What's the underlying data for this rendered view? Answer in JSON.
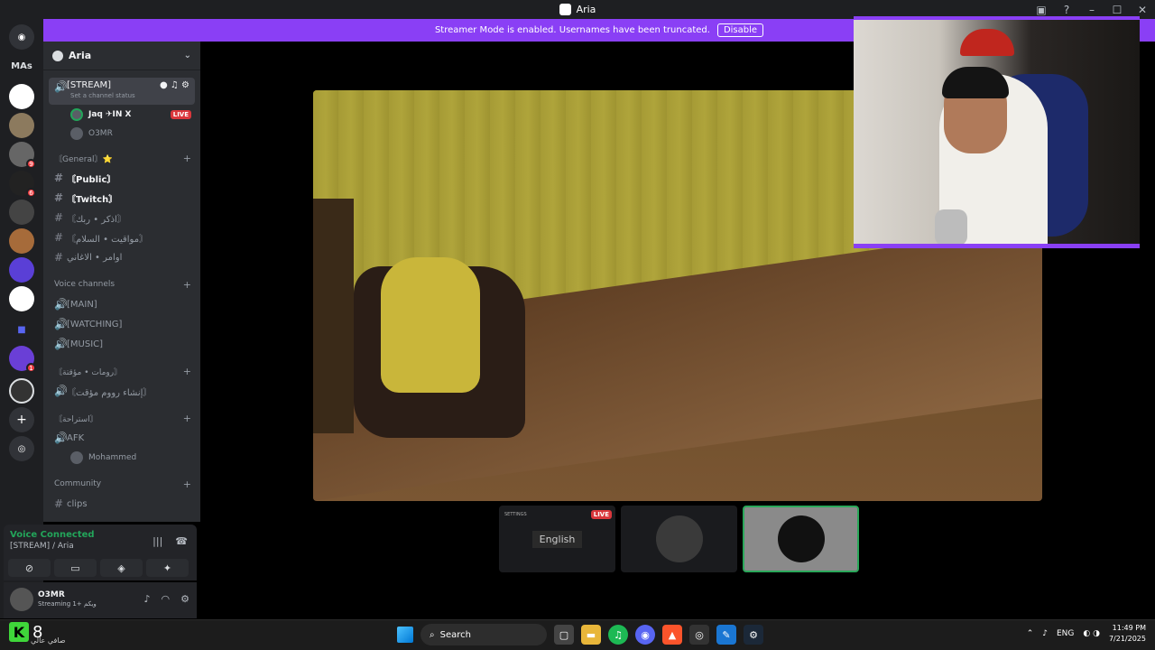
{
  "titlebar": {
    "title": "Aria"
  },
  "banner": {
    "text": "Streamer Mode is enabled. Usernames have been truncated.",
    "button": "Disable"
  },
  "rail": {
    "home_label": "MAs"
  },
  "server": {
    "name": "Aria"
  },
  "stream_channel": {
    "name": "[STREAM]",
    "status": "Set a channel status"
  },
  "stream_members": [
    {
      "name": "Jaq ✈IN X",
      "live": "LIVE"
    },
    {
      "name": "O3MR"
    }
  ],
  "categories": {
    "general": "〘General〙⭐",
    "voice": "Voice channels",
    "rooms": "〘رومات • مؤقتة〙",
    "rest": "〘استراحة〙",
    "community": "Community"
  },
  "text_channels": [
    "〘Public〙",
    "〘Twitch〙",
    "〘اذكر • ربك〙",
    "〘مواقيت • السلام〙",
    "اوامر • الاغاني"
  ],
  "voice_channels": [
    "[MAIN]",
    "[WATCHING]",
    "[MUSIC]"
  ],
  "temp_channel": "〘إنشاء رووم مؤقت〙",
  "afk_channel": "AFK",
  "afk_member": "Mohammed",
  "community_channel": "clips",
  "voice_panel": {
    "status": "Voice Connected",
    "location": "[STREAM] / Aria"
  },
  "user": {
    "name": "O3MR",
    "status": "Streaming ويكم +1"
  },
  "thumbs": {
    "live": "LIVE",
    "settings": "SETTINGS",
    "language": "English"
  },
  "taskbar": {
    "widget_num": "8",
    "widget_text": "صافي عالي",
    "search": "Search",
    "lang": "ENG",
    "time": "11:49 PM",
    "date": "7/21/2025"
  }
}
